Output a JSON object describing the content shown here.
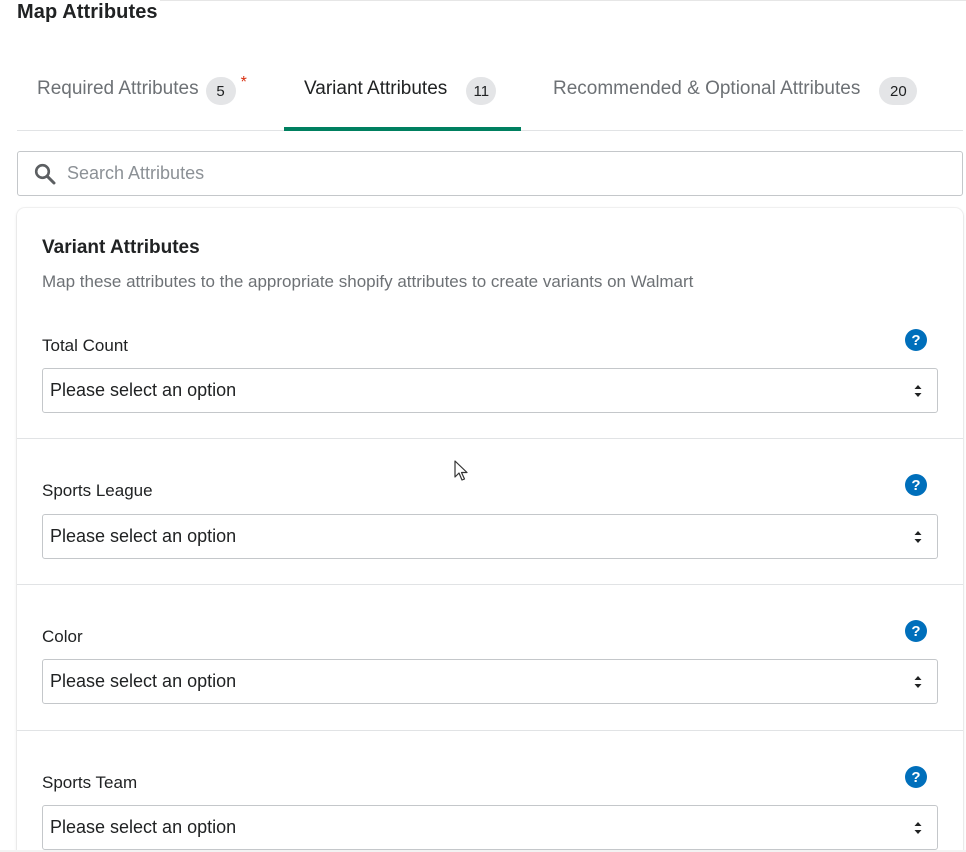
{
  "page": {
    "title": "Map Attributes"
  },
  "tabs": [
    {
      "label": "Required Attributes",
      "count": "5",
      "required_marker": "*"
    },
    {
      "label": "Variant Attributes",
      "count": "11"
    },
    {
      "label": "Recommended & Optional Attributes",
      "count": "20"
    }
  ],
  "active_tab": "Variant Attributes",
  "search": {
    "placeholder": "Search Attributes",
    "value": ""
  },
  "section": {
    "title": "Variant Attributes",
    "description": "Map these attributes to the appropriate shopify attributes to create variants on Walmart"
  },
  "fields": [
    {
      "label": "Total Count",
      "value": "Please select an option"
    },
    {
      "label": "Sports League",
      "value": "Please select an option"
    },
    {
      "label": "Color",
      "value": "Please select an option"
    },
    {
      "label": "Sports Team",
      "value": "Please select an option"
    }
  ],
  "icons": {
    "search": "search-icon",
    "help": "question-mark-icon",
    "select_arrow": "select-arrows-icon"
  },
  "colors": {
    "accent": "#008060",
    "help_icon": "#006fbb",
    "required": "#d82c0d"
  },
  "help_icon_glyph": "?"
}
